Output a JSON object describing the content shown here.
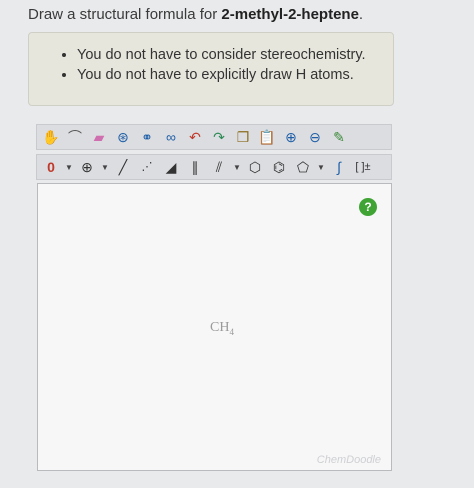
{
  "question": {
    "prefix": "Draw a structural formula for ",
    "compound": "2-methyl-2-heptene",
    "suffix": "."
  },
  "hints": [
    "You do not have to consider stereochemistry.",
    "You do not have to explicitly draw H atoms."
  ],
  "toolbar_top": {
    "tools": [
      "hand-tool",
      "lasso-tool",
      "eraser-tool",
      "ring-template-tool",
      "template-tool",
      "template-tool-2",
      "undo-tool",
      "redo-tool",
      "copy-tool",
      "paste-tool",
      "zoom-in-tool",
      "zoom-out-tool",
      "clean-tool"
    ]
  },
  "toolbar_bottom": {
    "charge_label": "0",
    "charge_plus": "⊕",
    "bracket_label": "[ ]±"
  },
  "canvas": {
    "help_label": "?",
    "atom_label": "CH",
    "atom_sub": "4",
    "brand": "ChemDoodle"
  },
  "colors": {
    "help": "#3fa434",
    "hint_bg": "#e7e6dd",
    "canvas_bg": "#f7f7f8"
  }
}
